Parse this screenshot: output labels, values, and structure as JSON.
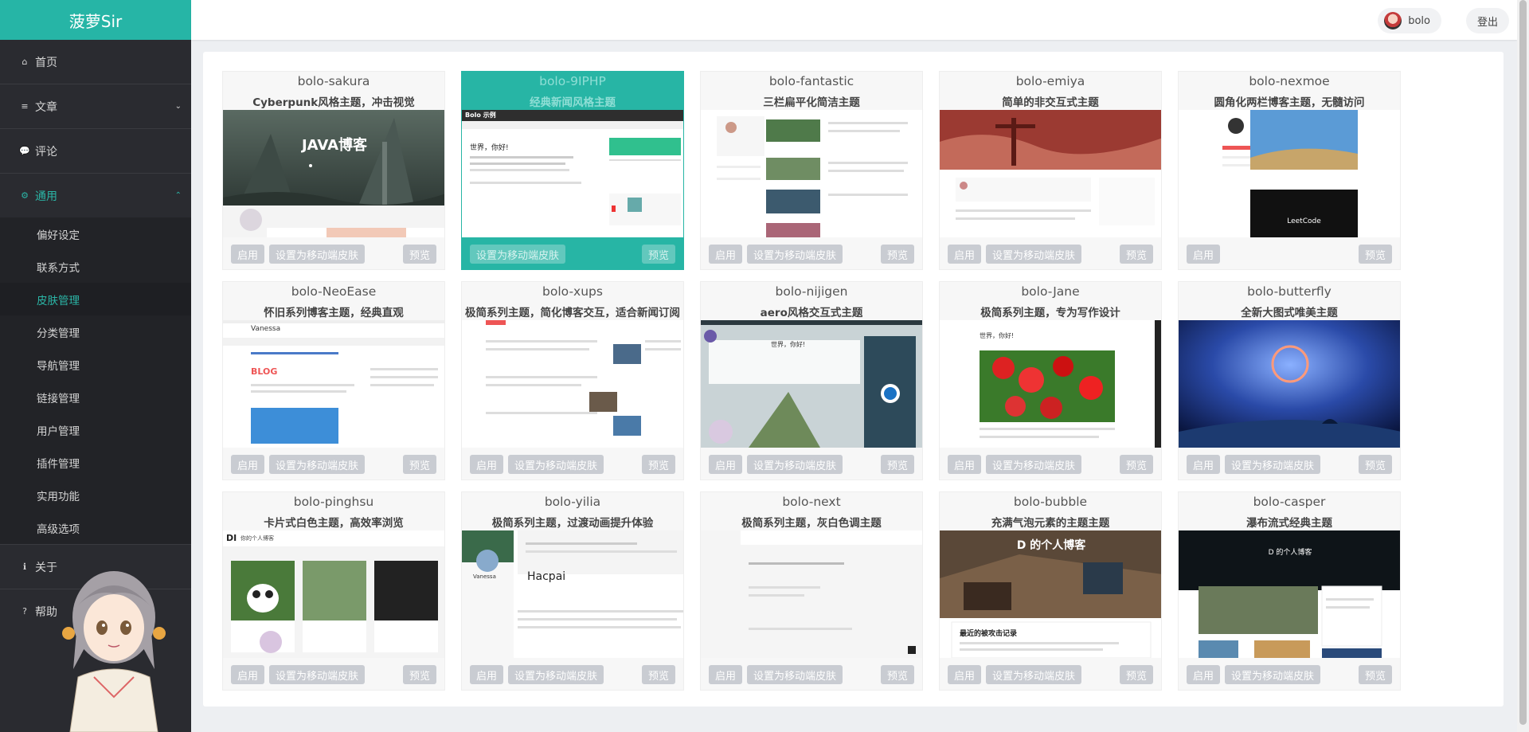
{
  "brand": "菠萝Sir",
  "nav": {
    "home": "首页",
    "articles": "文章",
    "comments": "评论",
    "general": "通用",
    "about": "关于",
    "help": "帮助"
  },
  "sub_nav": [
    "偏好设定",
    "联系方式",
    "皮肤管理",
    "分类管理",
    "导航管理",
    "链接管理",
    "用户管理",
    "插件管理",
    "实用功能",
    "高级选项"
  ],
  "header": {
    "user": "bolo",
    "logout": "登出"
  },
  "buttons": {
    "enable": "启用",
    "set_mobile": "设置为移动端皮肤",
    "preview": "预览"
  },
  "skins": [
    {
      "name": "bolo-sakura",
      "desc": "Cyberpunk风格主题，冲击视觉"
    },
    {
      "name": "bolo-9IPHP",
      "desc": "经典新闻风格主题"
    },
    {
      "name": "bolo-fantastic",
      "desc": "三栏扁平化简洁主题"
    },
    {
      "name": "bolo-emiya",
      "desc": "简单的非交互式主题"
    },
    {
      "name": "bolo-nexmoe",
      "desc": "圆角化两栏博客主题，无髓访问"
    },
    {
      "name": "bolo-NeoEase",
      "desc": "怀旧系列博客主题，经典直观"
    },
    {
      "name": "bolo-xups",
      "desc": "极简系列主题，简化博客交互，适合新闻订阅"
    },
    {
      "name": "bolo-nijigen",
      "desc": "aero风格交互式主题"
    },
    {
      "name": "bolo-Jane",
      "desc": "极简系列主题，专为写作设计"
    },
    {
      "name": "bolo-butterfly",
      "desc": "全新大图式唯美主题"
    },
    {
      "name": "bolo-pinghsu",
      "desc": "卡片式白色主题，高效率浏览"
    },
    {
      "name": "bolo-yilia",
      "desc": "极简系列主题，过渡动画提升体验"
    },
    {
      "name": "bolo-next",
      "desc": "极简系列主题，灰白色调主题"
    },
    {
      "name": "bolo-bubble",
      "desc": "充满气泡元素的主题主题"
    },
    {
      "name": "bolo-casper",
      "desc": "瀑布流式经典主题"
    }
  ],
  "preview_text": {
    "sakura": "JAVA博客",
    "iphp_logo": "Bolo 示例",
    "iphp_title": "世界，你好!",
    "neoease_brand": "Vanessa",
    "neoease_blog": "BLOG",
    "nijigen_title": "世界，你好!",
    "jane_title": "世界，你好!",
    "nexmoe_leetcode": "LeetCode",
    "pinghsu_logo": "DI",
    "pinghsu_sub": "你的个人博客",
    "yilia_name": "Vanessa",
    "yilia_post": "Hacpai",
    "bubble_title": "D 的个人博客",
    "bubble_post": "最近的被攻击记录",
    "casper_title": "D 的个人博客"
  },
  "current_skin_index": 1,
  "active_sub": 2
}
